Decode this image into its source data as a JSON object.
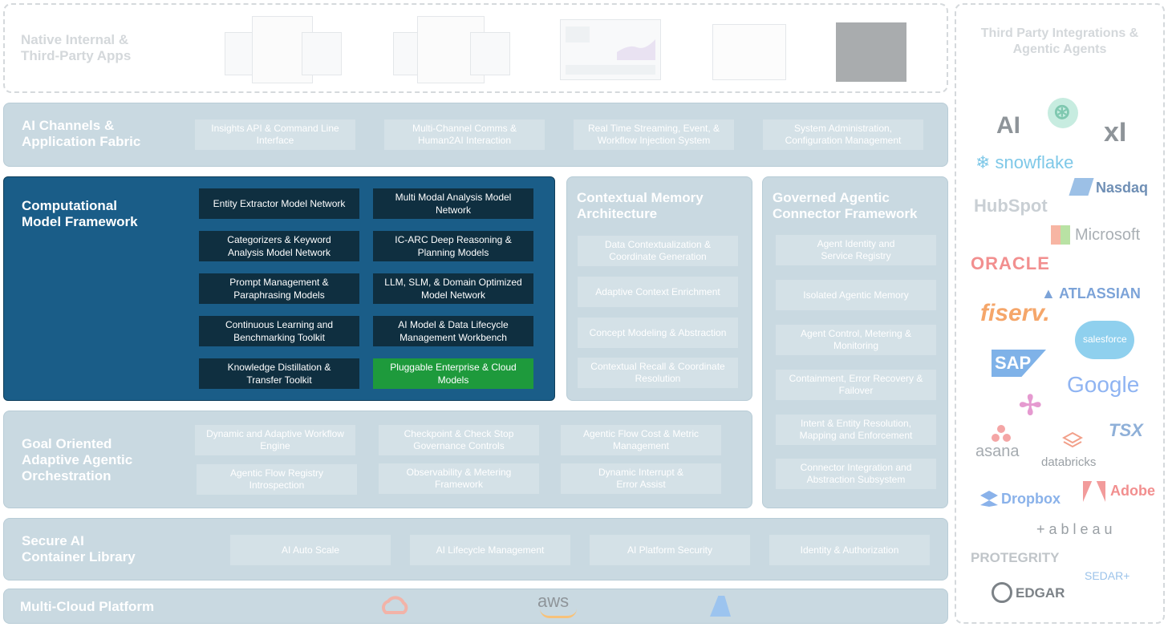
{
  "native_apps": {
    "title": "Native Internal &\nThird-Party Apps"
  },
  "ai_channels": {
    "title": "AI Channels &\nApplication Fabric",
    "items": [
      "Insights API & Command Line\nInterface",
      "Multi-Channel Comms &\nHuman2AI Interaction",
      "Real Time Streaming, Event, &\nWorkflow Injection System",
      "System Administration,\nConfiguration Management"
    ]
  },
  "computational": {
    "title": "Computational\nModel Framework",
    "items": [
      "Entity Extractor Model Network",
      "Multi Modal Analysis Model\nNetwork",
      "Categorizers & Keyword\nAnalysis Model Network",
      "IC-ARC Deep Reasoning &\nPlanning Models",
      "Prompt Management &\nParaphrasing Models",
      "LLM, SLM, & Domain Optimized\nModel Network",
      "Continuous Learning and\nBenchmarking Toolkit",
      "AI Model & Data Lifecycle\nManagement Workbench",
      "Knowledge Distillation &\nTransfer Toolkit",
      "Pluggable Enterprise  & Cloud\nModels"
    ],
    "highlight_color": "#1e9a3c"
  },
  "contextual_memory": {
    "title": "Contextual Memory\nArchitecture",
    "items": [
      "Data Contextualization &\nCoordinate Generation",
      "Adaptive Context Enrichment",
      "Concept Modeling & Abstraction",
      "Contextual Recall & Coordinate\nResolution"
    ]
  },
  "governed": {
    "title": "Governed Agentic\nConnector Framework",
    "items": [
      "Agent Identity and\nService Registry",
      "Isolated Agentic Memory",
      "Agent Control, Metering &\nMonitoring",
      "Containment, Error Recovery &\nFailover",
      "Intent & Entity Resolution,\nMapping and Enforcement",
      "Connector Integration and\nAbstraction Subsystem"
    ]
  },
  "orchestration": {
    "title": "Goal Oriented\nAdaptive Agentic\nOrchestration",
    "items": [
      "Dynamic and Adaptive Workflow\nEngine",
      "Checkpoint & Check Stop\nGovernance Controls",
      "Agentic Flow Cost & Metric\nManagement",
      "Agentic Flow Registry\nIntrospection",
      "Observability & Metering\nFramework",
      "Dynamic Interrupt &\nError Assist"
    ]
  },
  "container": {
    "title": "Secure AI\nContainer Library",
    "items": [
      "AI Auto Scale",
      "AI Lifecycle Management",
      "AI Platform Security",
      "Identity & Authorization"
    ]
  },
  "multicloud": {
    "title": "Multi-Cloud Platform",
    "aws_label": "aws"
  },
  "third_party": {
    "title": "Third Party Integrations &\nAgentic Agents",
    "logos": [
      {
        "text": "AI",
        "color": "#8e9499"
      },
      {
        "text": "⊛",
        "color": "#7fc8b0"
      },
      {
        "text": "xI",
        "color": "#8e9499"
      },
      {
        "text": "❄ snowflake",
        "color": "#7ec8e8"
      },
      {
        "text": "Nasdaq",
        "color": "#6f8fb5"
      },
      {
        "text": "HubSpot",
        "color": "#c9cfd4"
      },
      {
        "text": "Microsoft",
        "color": "#a9afb4"
      },
      {
        "text": "ORACLE",
        "color": "#f28f8f"
      },
      {
        "text": "▲ ATLASSIAN",
        "color": "#7ca3d8"
      },
      {
        "text": "fiserv.",
        "color": "#f5a66a"
      },
      {
        "text": "salesforce",
        "color": "#ffffff"
      },
      {
        "text": "SAP",
        "color": "#ffffff"
      },
      {
        "text": "Google",
        "color": "#8fb4f2"
      },
      {
        "text": "✢",
        "color": "#e59ad0"
      },
      {
        "text": "TSX",
        "color": "#8fb0d8"
      },
      {
        "text": "asana",
        "color": "#a5abb0"
      },
      {
        "text": "databricks",
        "color": "#9aa0a5"
      },
      {
        "text": "Dropbox",
        "color": "#8ab2ea"
      },
      {
        "text": "Adobe",
        "color": "#f28f8f"
      },
      {
        "text": "+ a b l e a u",
        "color": "#9aa0a5"
      },
      {
        "text": "PROTEGRITY",
        "color": "#c0c5c9"
      },
      {
        "text": "SEDAR+",
        "color": "#9cc3ea"
      },
      {
        "text": "EDGAR",
        "color": "#7c8287"
      }
    ]
  }
}
